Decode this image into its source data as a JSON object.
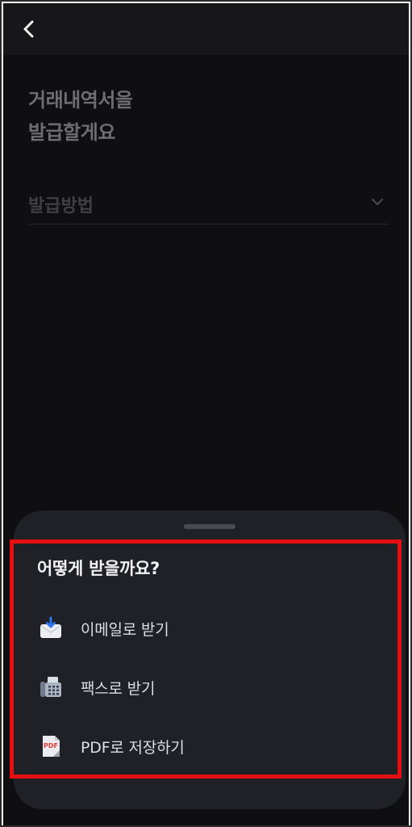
{
  "header": {
    "back_icon": "chevron-left-icon"
  },
  "page": {
    "title": "거래내역서을\n발급할게요",
    "method_placeholder": "발급방법",
    "method_icon": "chevron-down-icon"
  },
  "sheet": {
    "title": "어떻게 받을까요?",
    "options": [
      {
        "label": "이메일로 받기",
        "icon": "email-icon"
      },
      {
        "label": "팩스로 받기",
        "icon": "fax-icon"
      },
      {
        "label": "PDF로 저장하기",
        "icon": "pdf-file-icon"
      }
    ]
  },
  "colors": {
    "background": "#0f0f11",
    "sheet": "#202027",
    "highlight": "#e50f12"
  }
}
